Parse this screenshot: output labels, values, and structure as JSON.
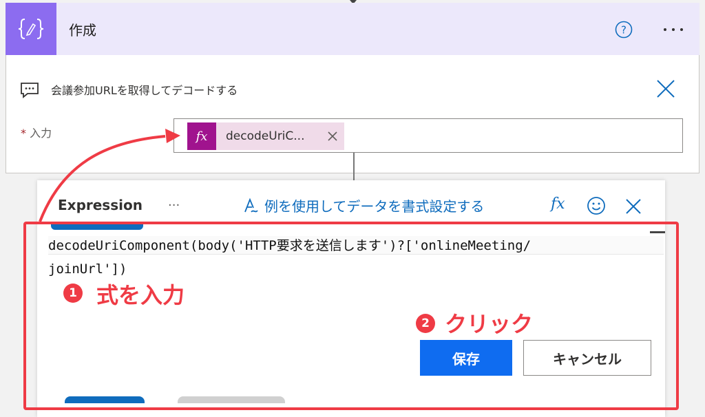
{
  "action_card": {
    "title": "作成",
    "comment": "会議参加URLを取得してデコードする",
    "input_required_mark": "*",
    "input_label": "入力",
    "token_fx": "fx",
    "token_label": "decodeUriC..."
  },
  "expression_panel": {
    "tab_label": "Expression",
    "ellipsis": "···",
    "format_link": "例を使用してデータを書式設定する",
    "fx_label": "fx",
    "expression_text": "decodeUriComponent(body('HTTP要求を送信します')?['onlineMeeting/\njoinUrl'])",
    "save_label": "保存",
    "cancel_label": "キャンセル"
  },
  "annotations": {
    "step1_number": "1",
    "step1_text": "式を入力",
    "step2_number": "2",
    "step2_text": "クリック"
  },
  "icons": {
    "compose": "compose-braces-icon",
    "help": "help-circle-icon",
    "more": "more-icon",
    "comment": "comment-icon",
    "close": "close-icon",
    "format": "format-pen-icon",
    "emoji": "smile-icon"
  },
  "colors": {
    "header_bg": "#ece8fb",
    "compose_icon_bg": "#8c6cf0",
    "token_bg": "#f0dbe9",
    "token_fx_bg": "#a0138e",
    "accent_blue": "#0f6cbd",
    "save_button": "#0f6cf0",
    "annotation_red": "#ef3b45"
  }
}
